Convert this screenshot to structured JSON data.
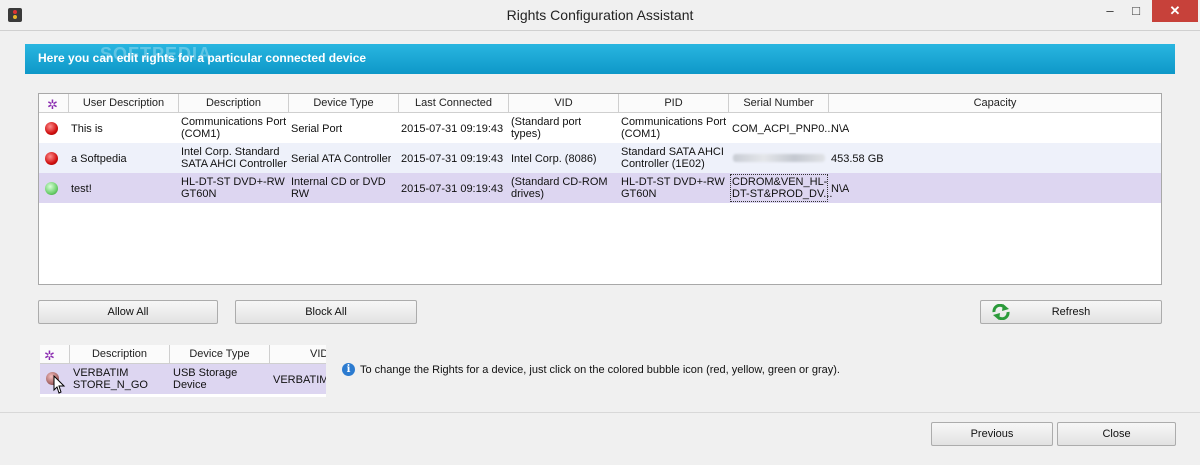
{
  "window": {
    "title": "Rights Configuration Assistant",
    "min": "–",
    "max": "□",
    "close": "✕"
  },
  "banner": {
    "text": "Here you can edit rights for a particular connected device",
    "watermark": "SOFTPEDIA"
  },
  "main_table": {
    "columns": [
      "User Description",
      "Description",
      "Device Type",
      "Last Connected",
      "VID",
      "PID",
      "Serial Number",
      "Capacity"
    ],
    "rows": [
      {
        "status": "red",
        "user_description": "This is",
        "description": [
          "Communications Port",
          "(COM1)"
        ],
        "device_type": "Serial Port",
        "last_connected": "2015-07-31 09:19:43",
        "vid": [
          "(Standard port",
          "types)"
        ],
        "pid": [
          "Communications Port",
          "(COM1)"
        ],
        "serial": [
          "COM_ACPI_PNP0..."
        ],
        "capacity": "N\\A"
      },
      {
        "status": "red",
        "user_description": "a Softpedia",
        "description": [
          "Intel Corp. Standard",
          "SATA AHCI Controller"
        ],
        "device_type": "Serial ATA Controller",
        "last_connected": "2015-07-31 09:19:43",
        "vid": [
          "Intel Corp. (8086)"
        ],
        "pid": [
          "Standard SATA AHCI",
          "Controller (1E02)"
        ],
        "serial": [],
        "capacity": "453.58 GB"
      },
      {
        "status": "green",
        "user_description": "test!",
        "description": [
          "HL-DT-ST DVD+-RW",
          "GT60N"
        ],
        "device_type": "Internal CD or DVD",
        "device_type_2": "RW",
        "last_connected": "2015-07-31 09:19:43",
        "vid": [
          "(Standard CD-ROM",
          "drives)"
        ],
        "pid": [
          "HL-DT-ST DVD+-RW",
          "GT60N"
        ],
        "serial": [
          "CDROM&VEN_HL-",
          "DT-ST&PROD_DV..."
        ],
        "capacity": "N\\A"
      }
    ]
  },
  "buttons": {
    "allow_all": "Allow All",
    "block_all": "Block All",
    "refresh": "Refresh",
    "previous": "Previous",
    "close": "Close"
  },
  "mini_table": {
    "columns": [
      "Description",
      "Device Type",
      "VID"
    ],
    "row": {
      "description": [
        "VERBATIM",
        "STORE_N_GO"
      ],
      "device_type": [
        "USB Storage",
        "Device"
      ],
      "vid": "VERBATIM"
    }
  },
  "info": {
    "icon": "i",
    "text": "To change the Rights for a device, just click on the colored bubble icon (red, yellow, green or gray)."
  },
  "icons": {
    "wand": "✲",
    "wand_name": "rights-wand-icon",
    "refresh_name": "refresh-icon",
    "info_name": "info-icon"
  },
  "colors": {
    "accent": "#1aa7d6",
    "selected_row": "#ddd6f1",
    "alt_row": "#eef1fa"
  }
}
